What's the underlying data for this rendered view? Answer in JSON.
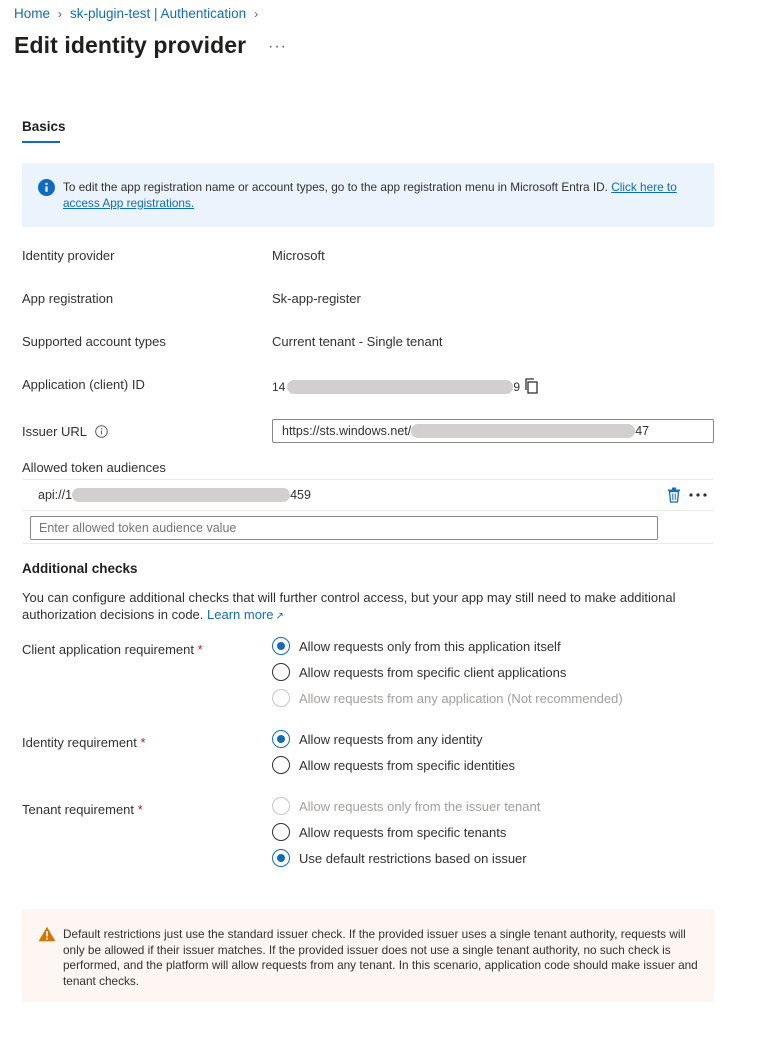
{
  "breadcrumb": {
    "home": "Home",
    "resource": "sk-plugin-test | Authentication"
  },
  "page": {
    "title": "Edit identity provider",
    "more": "···"
  },
  "tabs": {
    "basics": "Basics"
  },
  "info_banner": {
    "text": "To edit the app registration name or account types, go to the app registration menu in Microsoft Entra ID.",
    "link": "Click here to access App registrations."
  },
  "properties": {
    "identity_provider_label": "Identity provider",
    "identity_provider_value": "Microsoft",
    "app_registration_label": "App registration",
    "app_registration_value": "Sk-app-register",
    "account_types_label": "Supported account types",
    "account_types_value": "Current tenant - Single tenant",
    "client_id_label": "Application (client) ID",
    "client_id_prefix": "14",
    "client_id_suffix": "9",
    "issuer_label": "Issuer URL",
    "issuer_prefix": "https://sts.windows.net/",
    "issuer_suffix": "47",
    "audiences_label": "Allowed token audiences",
    "audience_prefix": "api://1",
    "audience_suffix": "459",
    "audience_placeholder": "Enter allowed token audience value"
  },
  "additional_checks": {
    "title": "Additional checks",
    "description": "You can configure additional checks that will further control access, but your app may still need to make additional authorization decisions in code.",
    "learn_more": "Learn more",
    "required_mark": "*",
    "client_req_label": "Client application requirement",
    "client_opt1": "Allow requests only from this application itself",
    "client_opt2": "Allow requests from specific client applications",
    "client_opt3": "Allow requests from any application (Not recommended)",
    "identity_req_label": "Identity requirement",
    "identity_opt1": "Allow requests from any identity",
    "identity_opt2": "Allow requests from specific identities",
    "tenant_req_label": "Tenant requirement",
    "tenant_opt1": "Allow requests only from the issuer tenant",
    "tenant_opt2": "Allow requests from specific tenants",
    "tenant_opt3": "Use default restrictions based on issuer"
  },
  "warning_banner": {
    "text": "Default restrictions just use the standard issuer check. If the provided issuer uses a single tenant authority, requests will only be allowed if their issuer matches. If the provided issuer does not use a single tenant authority, no such check is performed, and the platform will allow requests from any tenant. In this scenario, application code should make issuer and tenant checks."
  },
  "colors": {
    "accent": "#0f6cbd",
    "info_bg": "#ebf3fc",
    "warn_bg": "#fdf6f3",
    "warn_icon": "#d47500",
    "required": "#a4262c"
  }
}
